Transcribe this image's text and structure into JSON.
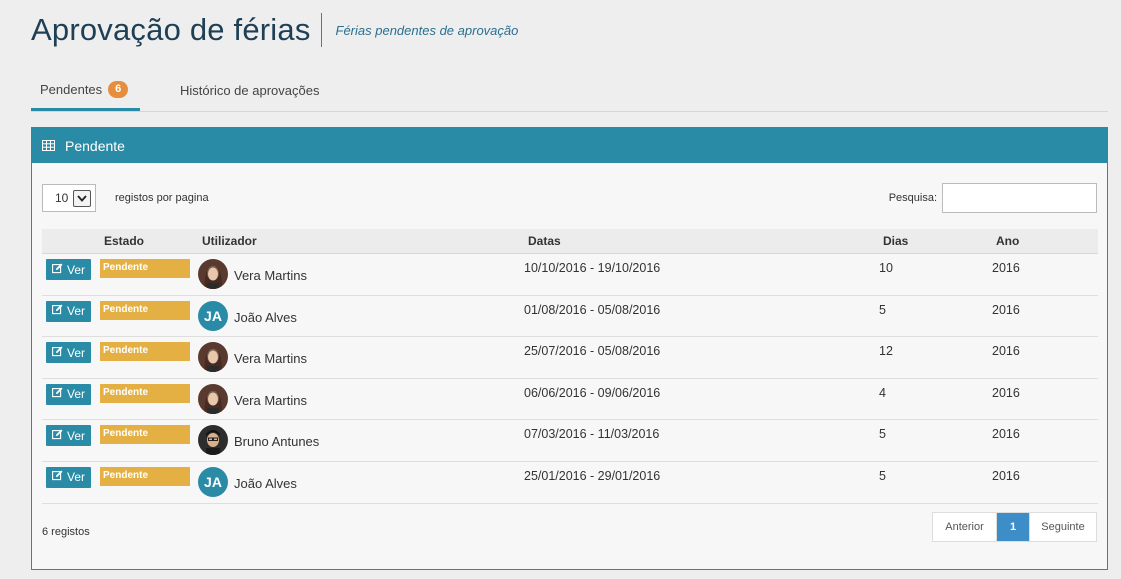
{
  "header": {
    "title": "Aprovação de férias",
    "subtitle": "Férias pendentes de aprovação"
  },
  "tabs": [
    {
      "label": "Pendentes",
      "badge": "6",
      "active": true
    },
    {
      "label": "Histórico de aprovações",
      "active": false
    }
  ],
  "panel": {
    "title": "Pendente",
    "icon": "table-grid-icon",
    "accent_color": "#2a8ba6"
  },
  "controls": {
    "page_size": "10",
    "per_page_label": "registos por pagina",
    "search_label": "Pesquisa:",
    "search_value": ""
  },
  "table": {
    "columns": [
      "Estado",
      "Utilizador",
      "Datas",
      "Dias",
      "Ano"
    ],
    "view_button_label": "Ver",
    "rows": [
      {
        "status": "Pendente",
        "user": "Vera Martins",
        "avatar": "photo",
        "dates": "10/10/2016 - 19/10/2016",
        "days": "10",
        "year": "2016"
      },
      {
        "status": "Pendente",
        "user": "João Alves",
        "avatar": "JA",
        "dates": "01/08/2016 - 05/08/2016",
        "days": "5",
        "year": "2016"
      },
      {
        "status": "Pendente",
        "user": "Vera Martins",
        "avatar": "photo",
        "dates": "25/07/2016 - 05/08/2016",
        "days": "12",
        "year": "2016"
      },
      {
        "status": "Pendente",
        "user": "Vera Martins",
        "avatar": "photo",
        "dates": "06/06/2016 - 09/06/2016",
        "days": "4",
        "year": "2016"
      },
      {
        "status": "Pendente",
        "user": "Bruno Antunes",
        "avatar": "photo-male",
        "dates": "07/03/2016 - 11/03/2016",
        "days": "5",
        "year": "2016"
      },
      {
        "status": "Pendente",
        "user": "João Alves",
        "avatar": "JA",
        "dates": "25/01/2016 - 29/01/2016",
        "days": "5",
        "year": "2016"
      }
    ]
  },
  "footer": {
    "count": "6 registos",
    "pagination": {
      "prev": "Anterior",
      "current": "1",
      "next": "Seguinte"
    }
  },
  "colors": {
    "brand": "#2a8ba6",
    "status_pending": "#e4b043",
    "badge": "#e68e3c",
    "active_page": "#3c8dc8"
  }
}
